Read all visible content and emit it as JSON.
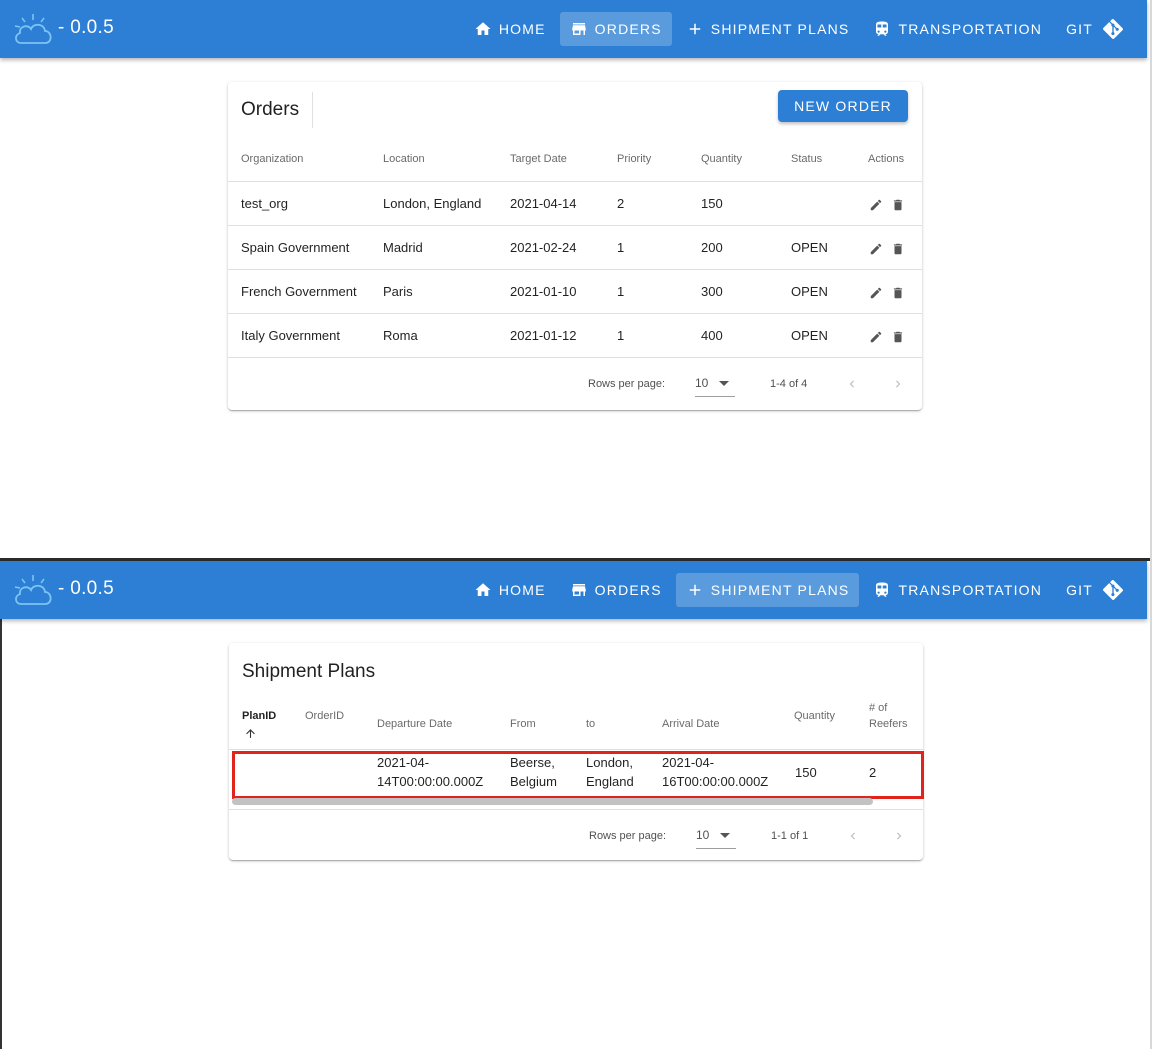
{
  "app": {
    "version": "- 0.0.5",
    "appbar_color": "#2c7fd4",
    "nav": {
      "home": "HOME",
      "orders": "ORDERS",
      "shipment_plans": "SHIPMENT PLANS",
      "transportation": "TRANSPORTATION",
      "git": "GIT"
    }
  },
  "orders_page": {
    "active_tab": "ORDERS",
    "title": "Orders",
    "new_order_label": "NEW ORDER",
    "columns": [
      "Organization",
      "Location",
      "Target Date",
      "Priority",
      "Quantity",
      "Status",
      "Actions"
    ],
    "rows": [
      {
        "organization": "test_org",
        "location": "London, England",
        "target_date": "2021-04-14",
        "priority": "2",
        "quantity": "150",
        "status": ""
      },
      {
        "organization": "Spain Government",
        "location": "Madrid",
        "target_date": "2021-02-24",
        "priority": "1",
        "quantity": "200",
        "status": "OPEN"
      },
      {
        "organization": "French Government",
        "location": "Paris",
        "target_date": "2021-01-10",
        "priority": "1",
        "quantity": "300",
        "status": "OPEN"
      },
      {
        "organization": "Italy Government",
        "location": "Roma",
        "target_date": "2021-01-12",
        "priority": "1",
        "quantity": "400",
        "status": "OPEN"
      }
    ],
    "pagination": {
      "rows_per_page_label": "Rows per page:",
      "rows_per_page": "10",
      "range": "1-4 of 4"
    }
  },
  "plans_page": {
    "active_tab": "SHIPMENT PLANS",
    "title": "Shipment Plans",
    "columns": {
      "plan_id": "PlanID",
      "order_id": "OrderID",
      "departure_date": "Departure Date",
      "from": "From",
      "to": "to",
      "arrival_date": "Arrival Date",
      "quantity": "Quantity",
      "reefers_line1": "# of",
      "reefers_line2": "Reefers"
    },
    "sort": {
      "column": "PlanID",
      "direction": "ascending",
      "icon": "arrow-up-icon"
    },
    "rows": [
      {
        "plan_id": "",
        "order_id": "",
        "departure_line1": "2021-04-",
        "departure_line2": "14T00:00:00.000Z",
        "from_line1": "Beerse,",
        "from_line2": "Belgium",
        "to_line1": "London,",
        "to_line2": "England",
        "arrival_line1": "2021-04-",
        "arrival_line2": "16T00:00:00.000Z",
        "quantity": "150",
        "reefers": "2"
      }
    ],
    "highlight_color": "#e0241c",
    "pagination": {
      "rows_per_page_label": "Rows per page:",
      "rows_per_page": "10",
      "range": "1-1 of 1"
    }
  }
}
